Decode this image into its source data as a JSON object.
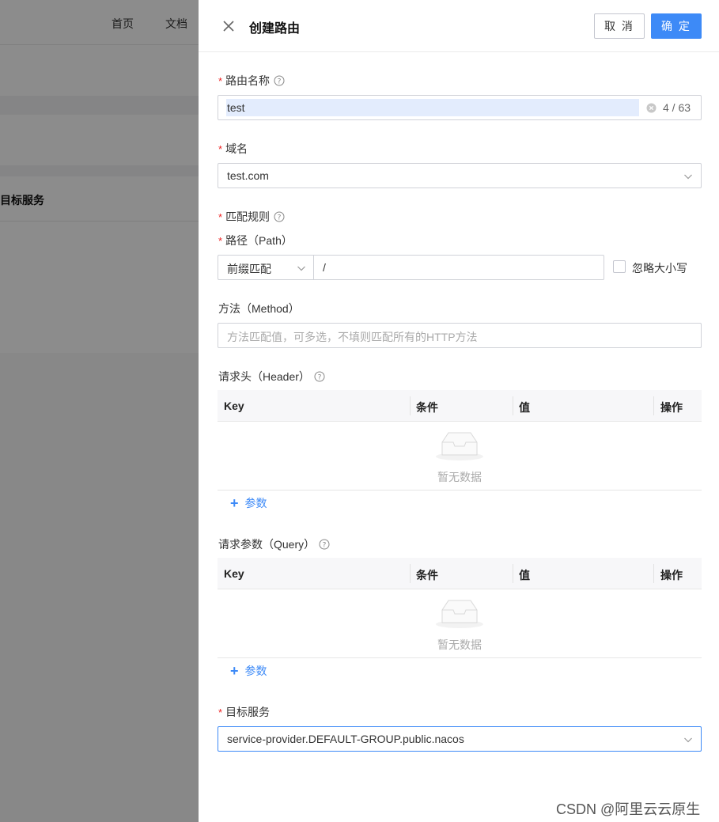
{
  "background": {
    "nav": [
      "首页",
      "文档"
    ],
    "section_label": "目标服务"
  },
  "drawer": {
    "title": "创建路由",
    "cancel_label": "取 消",
    "ok_label": "确 定"
  },
  "form": {
    "route_name": {
      "label": "路由名称",
      "value": "test",
      "counter": "4 / 63"
    },
    "domain": {
      "label": "域名",
      "value": "test.com"
    },
    "match_rules": {
      "label": "匹配规则"
    },
    "path": {
      "label": "路径（Path）",
      "match_type": "前缀匹配",
      "value": "/",
      "ignore_case_label": "忽略大小写"
    },
    "method": {
      "label": "方法（Method）",
      "placeholder": "方法匹配值，可多选，不填则匹配所有的HTTP方法"
    },
    "header": {
      "label": "请求头（Header）",
      "columns": [
        "Key",
        "条件",
        "值",
        "操作"
      ],
      "empty_text": "暂无数据",
      "add_label": "参数"
    },
    "query": {
      "label": "请求参数（Query）",
      "columns": [
        "Key",
        "条件",
        "值",
        "操作"
      ],
      "empty_text": "暂无数据",
      "add_label": "参数"
    },
    "target_service": {
      "label": "目标服务",
      "value": "service-provider.DEFAULT-GROUP.public.nacos"
    }
  },
  "watermark": "CSDN @阿里云云原生",
  "colors": {
    "primary": "#3d8af7",
    "required": "#ee2222",
    "mask": "rgba(0,0,0,0.45)"
  }
}
